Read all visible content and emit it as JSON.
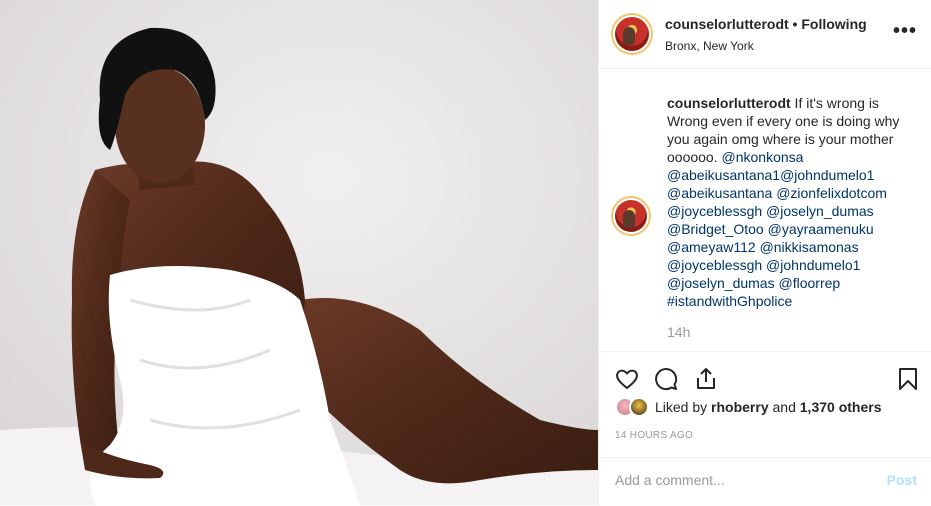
{
  "post": {
    "photo": {
      "description_icon": "photo-icon"
    },
    "header": {
      "username": "counselorlutterodt",
      "separator": " • ",
      "follow_status": "Following",
      "location": "Bronx, New York",
      "more_label": "•••"
    },
    "caption": {
      "username": "counselorlutterodt",
      "text": " If it's wrong is Wrong even if every one is doing why you again omg where is your mother oooooo. ",
      "mentions": [
        "@nkonkonsa",
        "@abeikusantana1@johndumelo1",
        "@abeikusantana",
        "@zionfelixdotcom",
        "@joyceblessgh",
        "@joselyn_dumas",
        "@Bridget_Otoo",
        "@yayraamenuku",
        "@ameyaw112",
        "@nikkisamonas",
        "@joyceblessgh",
        "@johndumelo1",
        "@joselyn_dumas",
        "@floorrep",
        "#istandwithGhpolice"
      ],
      "time": "14h"
    },
    "actions": {
      "like_icon": "heart-icon",
      "comment_icon": "comment-icon",
      "share_icon": "share-icon",
      "save_icon": "bookmark-icon"
    },
    "likes": {
      "prefix": "Liked by ",
      "user": "rhoberry",
      "middle": " and ",
      "count": "1,370 others"
    },
    "timestamp": "14 HOURS AGO",
    "add_comment": {
      "placeholder": "Add a comment...",
      "post_label": "Post"
    },
    "colors": {
      "mention": "#003569",
      "post_disabled": "#b2dffc",
      "muted": "#999999"
    }
  }
}
